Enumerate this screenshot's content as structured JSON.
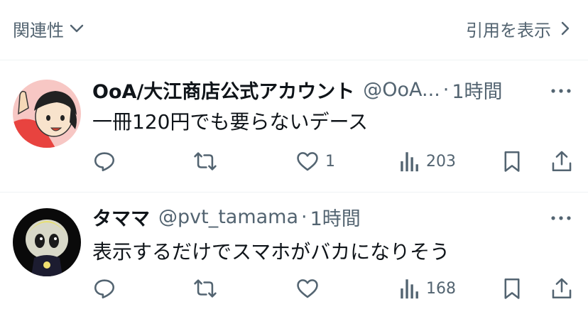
{
  "topbar": {
    "sort_label": "関連性",
    "quotes_label": "引用を表示"
  },
  "tweets": [
    {
      "name": "OoA/大江商店公式アカウント",
      "handle": "@OoA...",
      "dot": "·",
      "time": "1時間",
      "text": "一冊120円でも要らないデース",
      "like_count": "1",
      "view_count": "203"
    },
    {
      "name": "タママ",
      "handle": "@pvt_tamama",
      "dot": "·",
      "time": "1時間",
      "text": "表示するだけでスマホがバカになりそう",
      "like_count": "",
      "view_count": "168"
    }
  ],
  "colors": {
    "text_primary": "#0f1419",
    "text_secondary": "#536471",
    "divider": "#eff3f4"
  }
}
